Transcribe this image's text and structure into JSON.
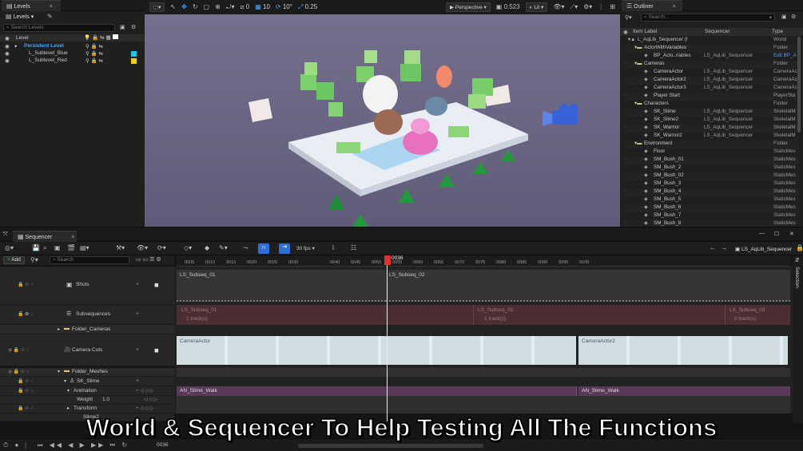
{
  "levels_panel": {
    "tab_label": "Levels",
    "levels_button": "Levels",
    "search_placeholder": "Search Levels",
    "column_header": "Level",
    "items": [
      {
        "name": "Persistent Level",
        "color": ""
      },
      {
        "name": "L_Sublevel_Blue",
        "color": "#19c6e6"
      },
      {
        "name": "L_Sublevel_Red",
        "color": "#f0d000"
      }
    ]
  },
  "viewport": {
    "perspective_label": "Perspective",
    "lit_label": "Lit",
    "snap_translate": "10",
    "snap_rotate": "10°",
    "snap_scale": "0.25",
    "camera_speed": "0.523",
    "grid_value": "0"
  },
  "outliner": {
    "tab_label": "Outliner",
    "search_placeholder": "Search...",
    "col_item_label": "Item Label",
    "col_sequencer": "Sequencer",
    "col_type": "Type",
    "rows": [
      {
        "label": "L_AqLib_Sequencer (I",
        "seq": "",
        "type": "World"
      },
      {
        "label": "ActorWithVariables",
        "seq": "",
        "type": "Folder"
      },
      {
        "label": "BP_Acto..riables",
        "seq": "LS_AqLib_Sequencer",
        "type": "Edit BP_A"
      },
      {
        "label": "Cameras",
        "seq": "",
        "type": "Folder"
      },
      {
        "label": "CameraActor",
        "seq": "LS_AqLib_Sequencer",
        "type": "CameraAc"
      },
      {
        "label": "CameraActor2",
        "seq": "LS_AqLib_Sequencer",
        "type": "CameraAc"
      },
      {
        "label": "CameraActor3",
        "seq": "LS_AqLib_Sequencer",
        "type": "CameraAc"
      },
      {
        "label": "Player Start",
        "seq": "",
        "type": "PlayerSta"
      },
      {
        "label": "Characters",
        "seq": "",
        "type": "Folder"
      },
      {
        "label": "SK_Slime",
        "seq": "LS_AqLib_Sequencer",
        "type": "SkeletalM"
      },
      {
        "label": "SK_Slime2",
        "seq": "LS_AqLib_Sequencer",
        "type": "SkeletalM"
      },
      {
        "label": "SK_Warrior",
        "seq": "LS_AqLib_Sequencer",
        "type": "SkeletalM"
      },
      {
        "label": "SK_Warrior2",
        "seq": "LS_AqLib_Sequencer",
        "type": "SkeletalM"
      },
      {
        "label": "Environment",
        "seq": "",
        "type": "Folder"
      },
      {
        "label": "Floor",
        "seq": "",
        "type": "StaticMes"
      },
      {
        "label": "SM_Bush_01",
        "seq": "",
        "type": "StaticMes"
      },
      {
        "label": "SM_Bush_2",
        "seq": "",
        "type": "StaticMes"
      },
      {
        "label": "SM_Bush_02",
        "seq": "",
        "type": "StaticMes"
      },
      {
        "label": "SM_Bush_3",
        "seq": "",
        "type": "StaticMes"
      },
      {
        "label": "SM_Bush_4",
        "seq": "",
        "type": "StaticMes"
      },
      {
        "label": "SM_Bush_5",
        "seq": "",
        "type": "StaticMes"
      },
      {
        "label": "SM_Bush_6",
        "seq": "",
        "type": "StaticMes"
      },
      {
        "label": "SM_Bush_7",
        "seq": "",
        "type": "StaticMes"
      },
      {
        "label": "SM_Bush_8",
        "seq": "",
        "type": "StaticMes"
      }
    ]
  },
  "sequencer": {
    "tab_label": "Sequencer",
    "fps_label": "30 fps",
    "sequence_name": "LS_AqLib_Sequencer",
    "add_label": "Add",
    "search_placeholder": "Search",
    "current_frame": "0036",
    "ruler_ticks": [
      "0005",
      "0010",
      "0015",
      "0020",
      "0025",
      "0030",
      "0040",
      "0045",
      "0050",
      "0055",
      "0060",
      "0065",
      "0070",
      "0075",
      "0080",
      "0085",
      "0090",
      "0095",
      "0100"
    ],
    "tracks": {
      "shots": "Shots",
      "subsequences": "Subsequences",
      "folder_cameras": "Folder_Cameras",
      "camera_cuts": "Camera Cuts",
      "folder_meshes": "Folder_Meshes",
      "sk_slime": "SK_Slime",
      "animation": "Animation",
      "weight": "Weight",
      "weight_value": "1.0",
      "transform": "Transform",
      "slime2": "Slime2"
    },
    "shots": [
      "LS_Subseq_01",
      "LS_Subseq_02"
    ],
    "subsequences": [
      {
        "name": "LS_Subseq_01",
        "track": "1 track(s)"
      },
      {
        "name": "LS_Subseq_02",
        "track": "1 track(s)"
      },
      {
        "name": "LS_Subseq_03",
        "track": "0 track(s)"
      }
    ],
    "camera_cuts": [
      "CameraActor",
      "CameraActor2"
    ],
    "animations": [
      "AN_Slime_Walk",
      "AN_Slime_Walk"
    ],
    "selection_label": "Selection",
    "bottom_frame": "0036"
  },
  "caption": "World & Sequencer To Help Testing All The Functions"
}
